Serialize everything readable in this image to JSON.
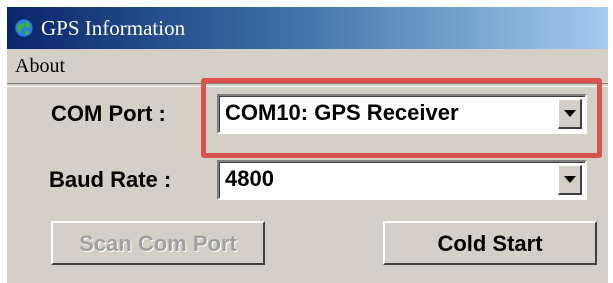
{
  "window": {
    "title": "GPS Information"
  },
  "menu": {
    "items": [
      {
        "label": "About"
      }
    ]
  },
  "form": {
    "com_port": {
      "label": "COM Port :",
      "value": "COM10:  GPS Receiver"
    },
    "baud_rate": {
      "label": "Baud Rate :",
      "value": "4800"
    }
  },
  "buttons": {
    "scan_com_port": {
      "label": "Scan Com Port",
      "enabled": false
    },
    "cold_start": {
      "label": "Cold Start",
      "enabled": true
    }
  },
  "colors": {
    "titlebar_start": "#0a246a",
    "titlebar_end": "#a6caf0",
    "window_face": "#d4d0c8",
    "highlight_box": "#d9534f"
  },
  "icons": {
    "app": "globe-icon",
    "dropdown": "chevron-down-icon"
  }
}
